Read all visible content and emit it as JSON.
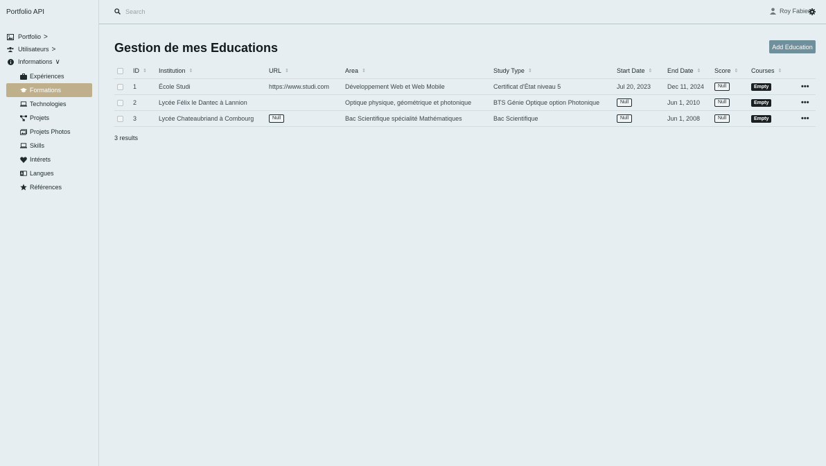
{
  "app": {
    "title": "Portfolio API"
  },
  "sidebar": {
    "top_items": [
      {
        "label": "Portfolio",
        "icon": "image-icon",
        "chevron": ">"
      },
      {
        "label": "Utilisateurs",
        "icon": "users-icon",
        "chevron": ">"
      },
      {
        "label": "Informations",
        "icon": "info-icon",
        "chevron": "∨"
      }
    ],
    "sub_items": [
      {
        "label": "Expériences",
        "icon": "briefcase-icon",
        "active": false
      },
      {
        "label": "Formations",
        "icon": "graduation-cap-icon",
        "active": true
      },
      {
        "label": "Technologies",
        "icon": "laptop-icon",
        "active": false
      },
      {
        "label": "Projets",
        "icon": "project-diagram-icon",
        "active": false
      },
      {
        "label": "Projets Photos",
        "icon": "images-icon",
        "active": false
      },
      {
        "label": "Skills",
        "icon": "laptop-icon",
        "active": false
      },
      {
        "label": "Intérets",
        "icon": "heart-icon",
        "active": false
      },
      {
        "label": "Langues",
        "icon": "language-icon",
        "active": false
      },
      {
        "label": "Références",
        "icon": "star-icon",
        "active": false
      }
    ],
    "active_color": "#bfb08b"
  },
  "topbar": {
    "search_placeholder": "Search",
    "user_name": "Roy Fabien"
  },
  "main": {
    "title": "Gestion de mes Educations",
    "add_button": "Add Education",
    "columns": [
      "ID",
      "Institution",
      "URL",
      "Area",
      "Study Type",
      "Start Date",
      "End Date",
      "Score",
      "Courses"
    ],
    "rows": [
      {
        "id": "1",
        "institution": "École Studi",
        "url": "https://www.studi.com",
        "area": "Développement Web et Web Mobile",
        "study_type": "Certificat d'État niveau 5",
        "start_date": "Jul 20, 2023",
        "end_date": "Dec 11, 2024",
        "score": "Null",
        "courses": "Empty"
      },
      {
        "id": "2",
        "institution": "Lycée Félix le Dantec à Lannion",
        "url": "",
        "area": "Optique physique, géométrique et photonique",
        "study_type": "BTS Génie Optique option Photonique",
        "start_date": "Null",
        "end_date": "Jun 1, 2010",
        "score": "Null",
        "courses": "Empty"
      },
      {
        "id": "3",
        "institution": "Lycée Chateaubriand à Combourg",
        "url": "Null",
        "area": "Bac Scientifique spécialité Mathématiques",
        "study_type": "Bac Scientifique",
        "start_date": "Null",
        "end_date": "Jun 1, 2008",
        "score": "Null",
        "courses": "Empty"
      }
    ],
    "results": "3 results",
    "more_label": "•••"
  }
}
